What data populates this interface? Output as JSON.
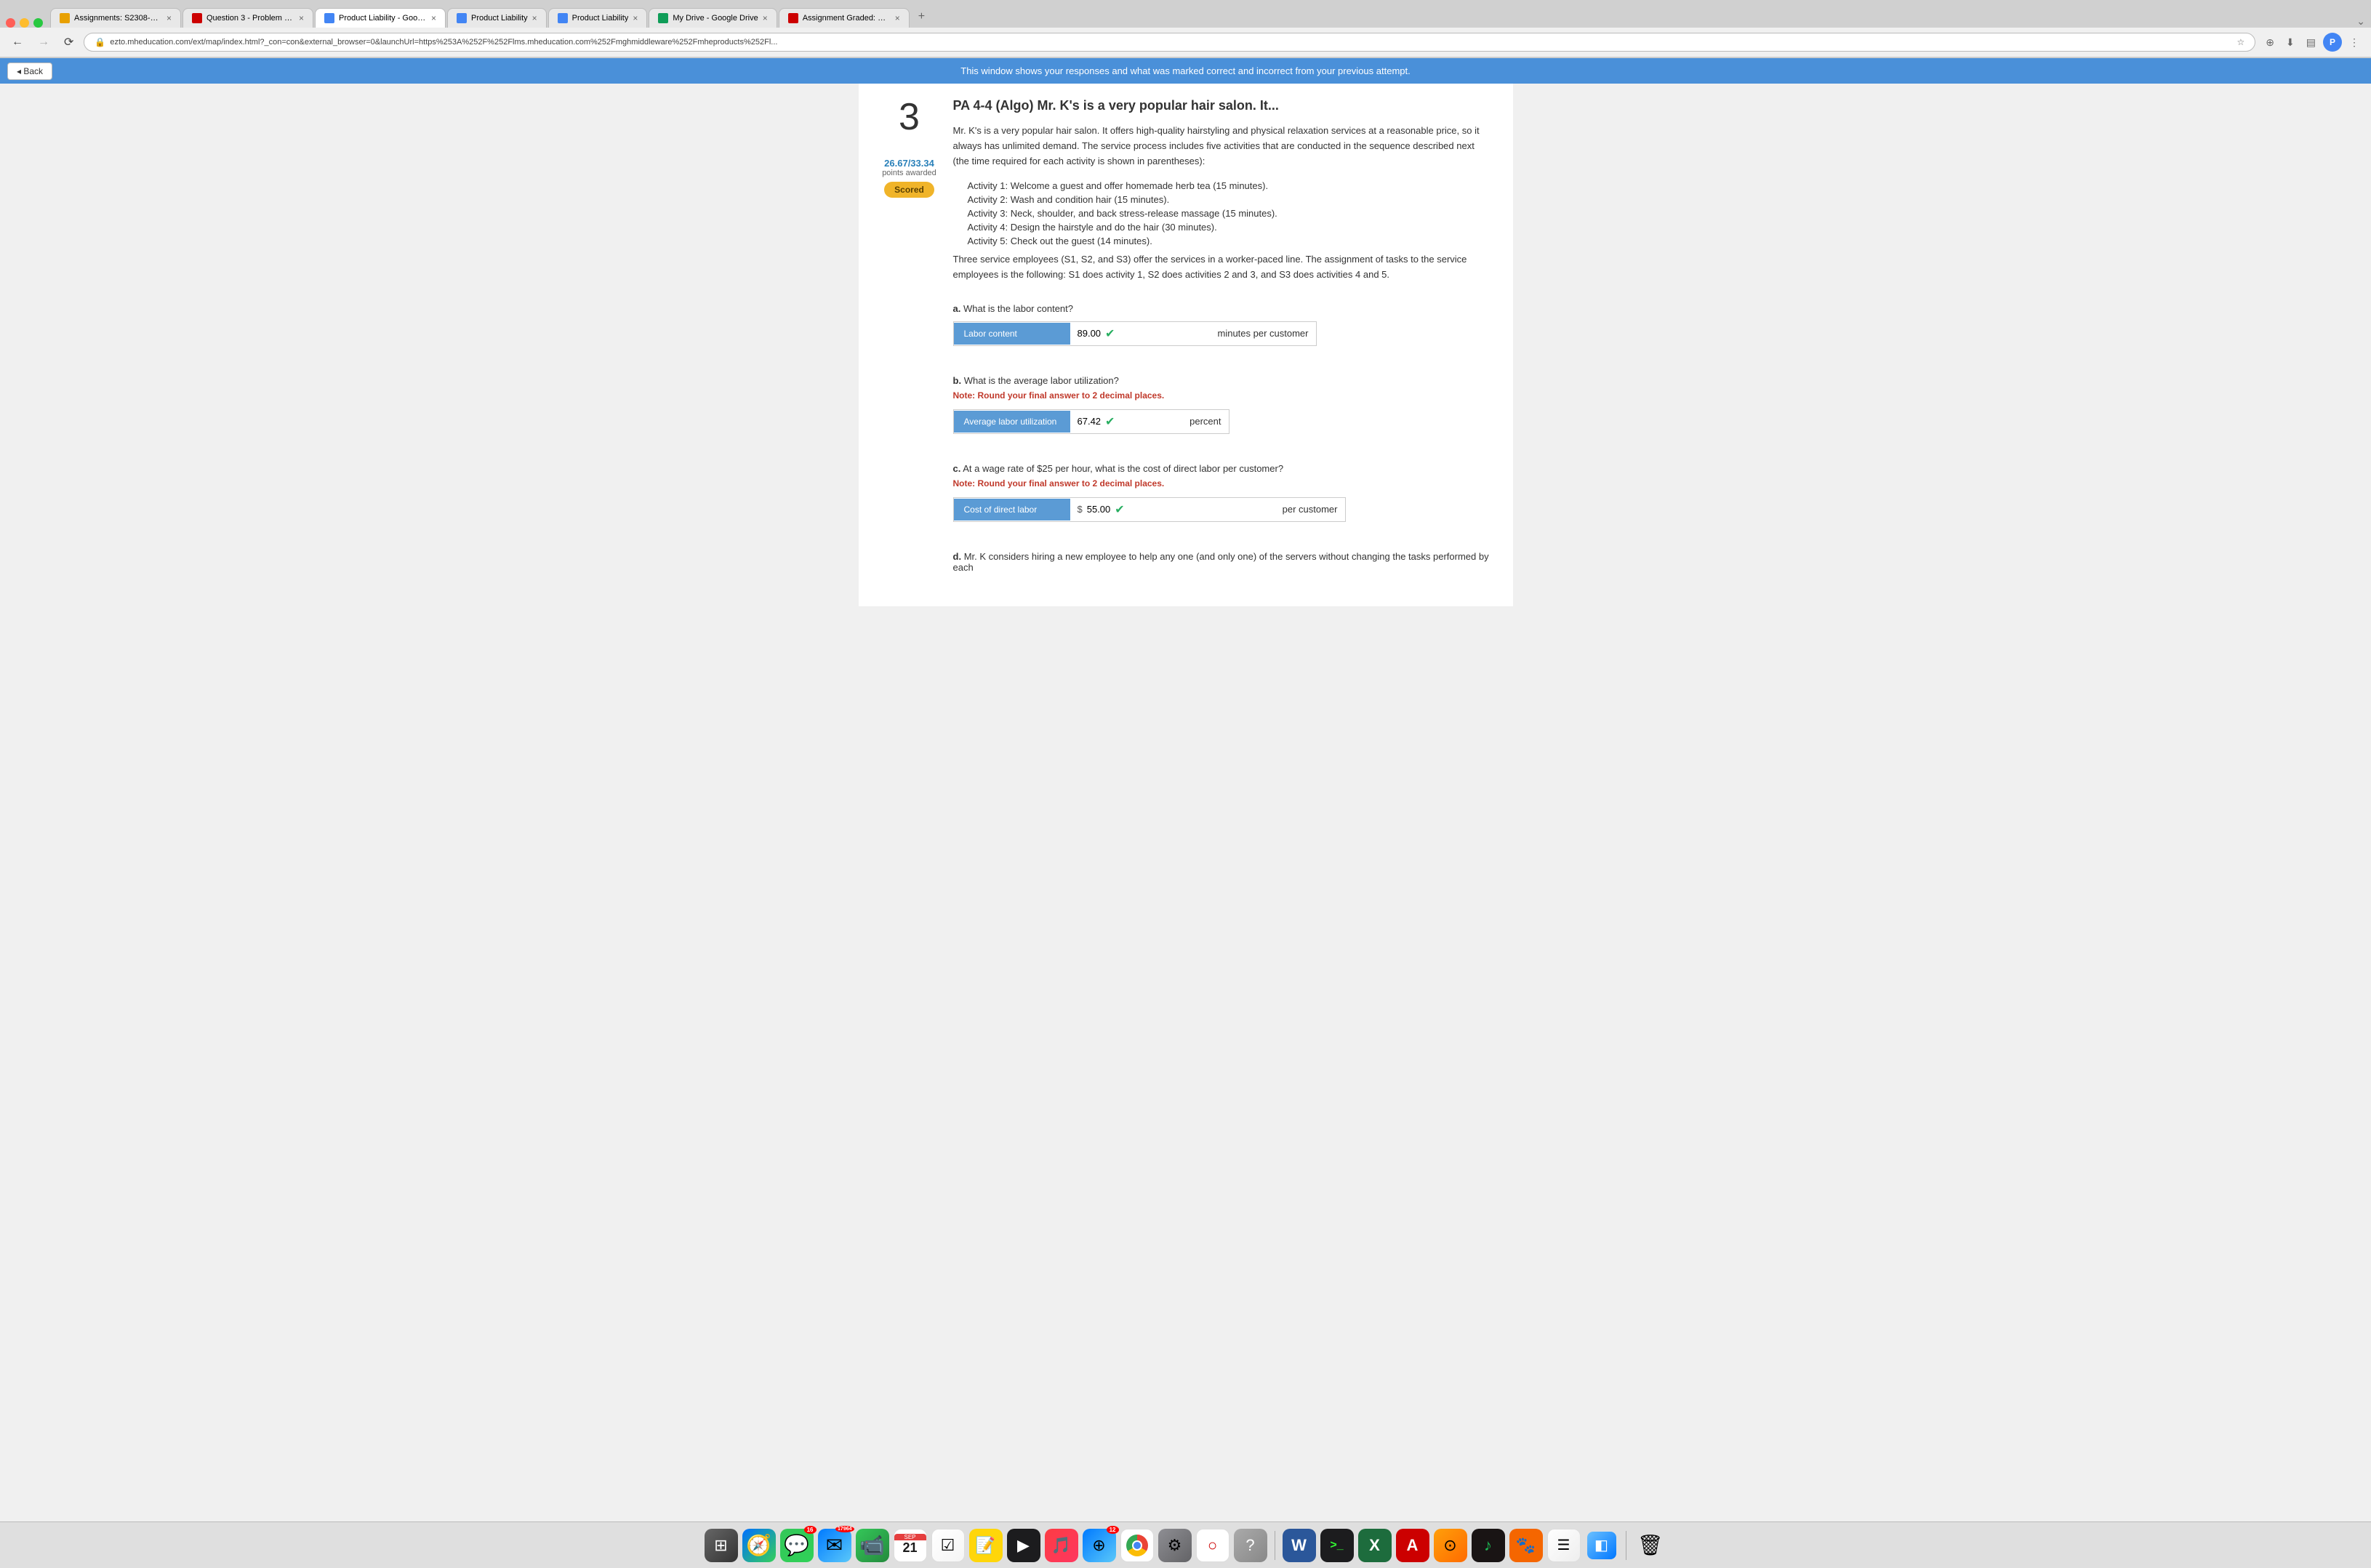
{
  "browser": {
    "tabs": [
      {
        "id": "tab1",
        "favicon_color": "orange",
        "label": "Assignments: S2308-M...",
        "active": false,
        "closeable": true
      },
      {
        "id": "tab2",
        "favicon_color": "red",
        "label": "Question 3 - Problem S...",
        "active": false,
        "closeable": true
      },
      {
        "id": "tab3",
        "favicon_color": "blue",
        "label": "Product Liability - Goog...",
        "active": true,
        "closeable": true
      },
      {
        "id": "tab4",
        "favicon_color": "blue",
        "label": "Product Liability",
        "active": false,
        "closeable": true
      },
      {
        "id": "tab5",
        "favicon_color": "blue",
        "label": "Product Liability",
        "active": false,
        "closeable": true
      },
      {
        "id": "tab6",
        "favicon_color": "green",
        "label": "My Drive - Google Drive",
        "active": false,
        "closeable": true
      },
      {
        "id": "tab7",
        "favicon_color": "red",
        "label": "Assignment Graded: Pr...",
        "active": false,
        "closeable": true
      }
    ],
    "address": "ezto.mheducation.com/ext/map/index.html?_con=con&external_browser=0&launchUrl=https%253A%252F%252Flms.mheducation.com%252Fmghmiddleware%252Fmheproducts%252Fl...",
    "profile_initial": "P"
  },
  "banner": {
    "back_label": "◂ Back",
    "message": "This window shows your responses and what was marked correct and incorrect from your previous attempt."
  },
  "question": {
    "number": "3",
    "title": "PA 4-4 (Algo) Mr. K's is a very popular hair salon. It...",
    "points_awarded": "26.67/33.34",
    "points_label": "points awarded",
    "scored_label": "Scored",
    "description_1": "Mr. K's is a very popular hair salon. It offers high-quality hairstyling and physical relaxation services at a reasonable price, so it always has unlimited demand. The service process includes five activities that are conducted in the sequence described next (the time required for each activity is shown in parentheses):",
    "activities": [
      "Activity 1: Welcome a guest and offer homemade herb tea (15 minutes).",
      "Activity 2: Wash and condition hair (15 minutes).",
      "Activity 3: Neck, shoulder, and back stress-release massage (15 minutes).",
      "Activity 4: Design the hairstyle and do the hair (30 minutes).",
      "Activity 5: Check out the guest (14 minutes)."
    ],
    "description_2": "Three service employees (S1, S2, and S3) offer the services in a worker-paced line. The assignment of tasks to the service employees is the following: S1 does activity 1, S2 does activities 2 and 3, and S3 does activities 4 and 5.",
    "parts": {
      "a": {
        "question": "What is the labor content?",
        "answer_label": "Labor content",
        "answer_value": "89.00",
        "answer_unit": "minutes per customer",
        "correct": true
      },
      "b": {
        "question": "What is the average labor utilization?",
        "note": "Note: Round your final answer to 2 decimal places.",
        "answer_label": "Average labor utilization",
        "answer_value": "67.42",
        "answer_unit": "percent",
        "correct": true
      },
      "c": {
        "question": "At a wage rate of $25 per hour, what is the cost of direct labor per customer?",
        "note": "Note: Round your final answer to 2 decimal places.",
        "answer_label": "Cost of direct labor",
        "dollar_sign": "$",
        "answer_value": "55.00",
        "answer_unit": "per customer",
        "correct": true
      },
      "d": {
        "question": "Mr. K considers hiring a new employee to help any one (and only one) of the servers without changing the tasks performed by each"
      }
    }
  },
  "dock": {
    "apps": [
      {
        "name": "Launchpad",
        "label": "⊞",
        "color_class": "dock-launchpad"
      },
      {
        "name": "Safari",
        "label": "🧭",
        "color_class": "dock-safari"
      },
      {
        "name": "Messages",
        "label": "💬",
        "color_class": "dock-messages",
        "badge": "16"
      },
      {
        "name": "Mail",
        "label": "✉",
        "color_class": "dock-mail",
        "badge": "17964"
      },
      {
        "name": "FaceTime",
        "label": "📹",
        "color_class": "dock-facetime"
      },
      {
        "name": "Calendar",
        "label": "📅",
        "color_class": "dock-calendar",
        "day": "21",
        "month": "SEP"
      },
      {
        "name": "Reminders",
        "label": "☑",
        "color_class": "dock-reminders"
      },
      {
        "name": "Notes",
        "label": "📝",
        "color_class": "dock-notes"
      },
      {
        "name": "TV",
        "label": "▶",
        "color_class": "dock-tv"
      },
      {
        "name": "Music",
        "label": "🎵",
        "color_class": "dock-music"
      },
      {
        "name": "App Store",
        "label": "⊕",
        "color_class": "dock-appstore",
        "badge": "12"
      },
      {
        "name": "Chrome",
        "label": "●",
        "color_class": "dock-chrome"
      },
      {
        "name": "System Settings",
        "label": "⚙",
        "color_class": "dock-settings"
      },
      {
        "name": "Office",
        "label": "○",
        "color_class": "dock-office"
      },
      {
        "name": "Help",
        "label": "?",
        "color_class": "dock-settings"
      },
      {
        "name": "Word",
        "label": "W",
        "color_class": "dock-mail"
      },
      {
        "name": "Terminal",
        "label": ">_",
        "color_class": "dock-term"
      },
      {
        "name": "Excel",
        "label": "X",
        "color_class": "dock-excel"
      },
      {
        "name": "Acrobat",
        "label": "A",
        "color_class": "dock-acrobat"
      },
      {
        "name": "Preview",
        "label": "⊙",
        "color_class": "dock-preview"
      },
      {
        "name": "Spotify",
        "label": "♪",
        "color_class": "dock-spotify"
      },
      {
        "name": "Clemson",
        "label": "🐾",
        "color_class": "dock-clemson"
      },
      {
        "name": "Pages",
        "label": "☰",
        "color_class": "dock-pages"
      },
      {
        "name": "Finder",
        "label": "◧",
        "color_class": "dock-trash"
      },
      {
        "name": "Trash",
        "label": "🗑",
        "color_class": "dock-trash"
      }
    ]
  }
}
